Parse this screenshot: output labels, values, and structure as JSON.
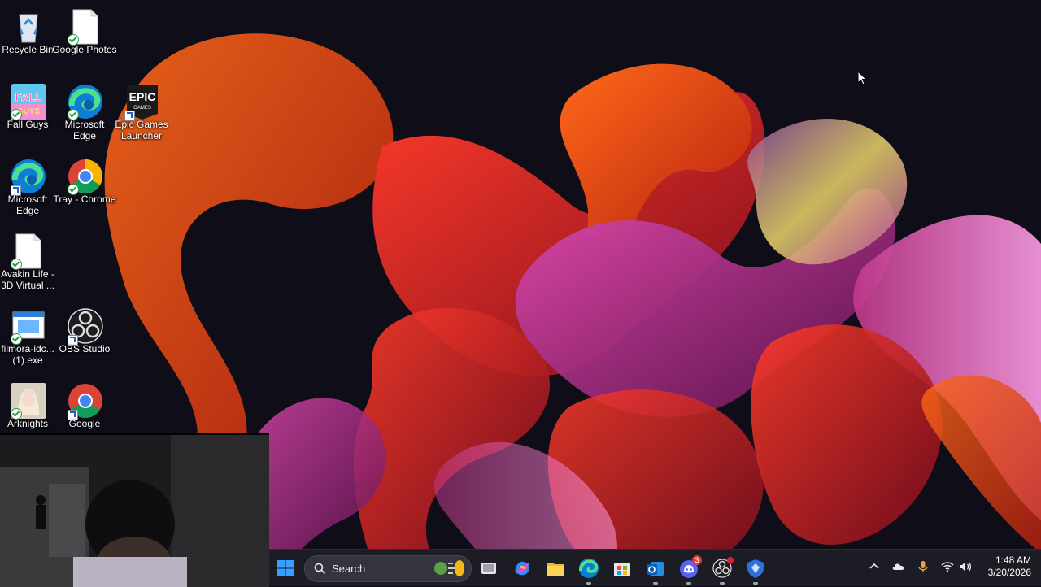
{
  "desktop": {
    "icons": [
      {
        "label": "Recycle Bin"
      },
      {
        "label": "Google Photos"
      },
      {
        "label": "Fall Guys"
      },
      {
        "label": "Microsoft Edge"
      },
      {
        "label": "Epic Games Launcher",
        "logo_text": "EPIC",
        "logo_sub": "GAMES"
      },
      {
        "label": "Microsoft Edge"
      },
      {
        "label": "Tray - Chrome"
      },
      {
        "label": "Avakin Life - 3D Virtual ..."
      },
      {
        "label": "filmora-idc... (1).exe"
      },
      {
        "label": "OBS Studio"
      },
      {
        "label": "Arknights"
      },
      {
        "label": "Google"
      }
    ]
  },
  "taskbar": {
    "search_label": "Search",
    "discord_badge": "3",
    "clock": {
      "time": "1:48 AM",
      "date": "3/20/2026"
    }
  },
  "colors": {
    "taskbar_bg": "#1c1c24",
    "accent": "#0078d4",
    "wallpaper_bg": "#0f0d18"
  }
}
